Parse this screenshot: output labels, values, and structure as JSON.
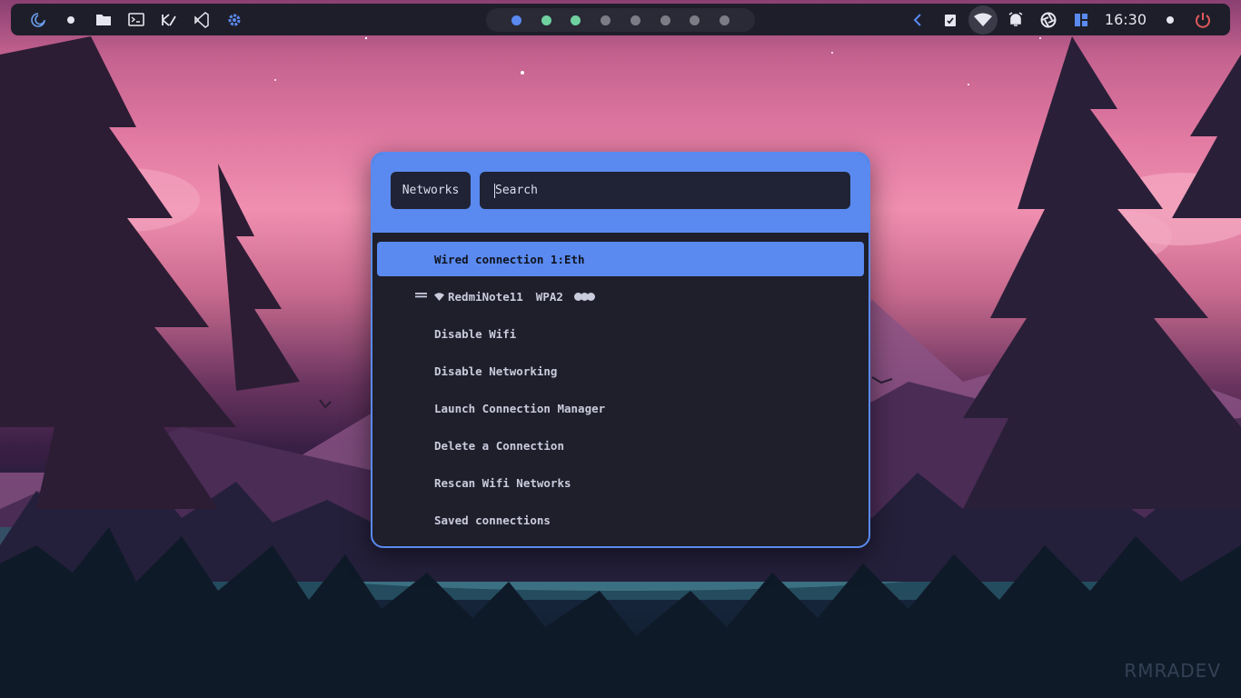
{
  "topbar": {
    "left_icons": [
      "arch-logo-icon",
      "dot-icon",
      "folder-icon",
      "terminal-icon",
      "kate-editor-icon",
      "vscode-icon",
      "settings-gear-icon"
    ],
    "workspaces": [
      {
        "color": "#5a8af0"
      },
      {
        "color": "#6fd1a0"
      },
      {
        "color": "#6fd1a0"
      },
      {
        "color": "#7c7c86"
      },
      {
        "color": "#7c7c86"
      },
      {
        "color": "#7c7c86"
      },
      {
        "color": "#7c7c86"
      },
      {
        "color": "#7c7c86"
      }
    ],
    "right_icons": [
      "chevron-left-icon",
      "checklist-icon",
      "wifi-icon",
      "alarm-icon",
      "aperture-icon",
      "layout-icon"
    ],
    "clock": "16:30",
    "power_color": "#e05a5a"
  },
  "launcher": {
    "prompt": "Networks",
    "search_placeholder": "Search",
    "accent": "#5a8af0",
    "items": [
      {
        "label": "Wired connection 1:Eth"
      },
      {
        "ssid": "RedmiNote11",
        "security": "WPA2"
      },
      {
        "label": "Disable Wifi"
      },
      {
        "label": "Disable Networking"
      },
      {
        "label": "Launch Connection Manager"
      },
      {
        "label": "Delete a Connection"
      },
      {
        "label": "Rescan Wifi Networks"
      },
      {
        "label": "Saved connections"
      }
    ]
  },
  "watermark": "RMRADEV"
}
